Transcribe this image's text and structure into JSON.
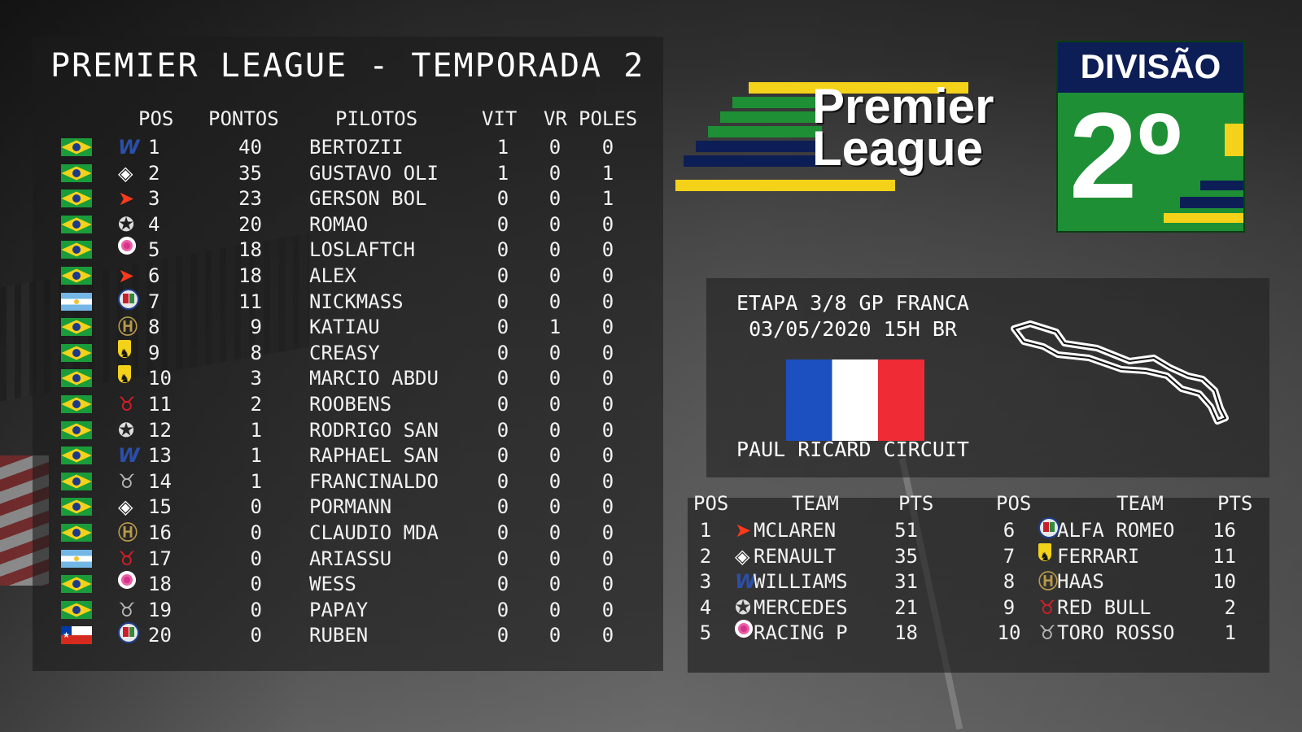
{
  "title": "PREMIER LEAGUE - TEMPORADA 2",
  "logo": {
    "line1": "Premier",
    "line2": "League"
  },
  "division": {
    "label": "DIVISÃO",
    "number": "2º"
  },
  "driver_headers": {
    "pos": "POS",
    "points": "PONTOS",
    "drivers": "PILOTOS",
    "wins": "VIT",
    "fastest_laps": "VR",
    "poles": "POLES"
  },
  "drivers": [
    {
      "pos": "1",
      "flag": "br",
      "team": "williams",
      "points": "40",
      "name": "BERTOZII",
      "vit": "1",
      "vr": "0",
      "poles": "0"
    },
    {
      "pos": "2",
      "flag": "br",
      "team": "renault",
      "points": "35",
      "name": "GUSTAVO OLI",
      "vit": "1",
      "vr": "0",
      "poles": "1"
    },
    {
      "pos": "3",
      "flag": "br",
      "team": "mclaren",
      "points": "23",
      "name": "GERSON BOL",
      "vit": "0",
      "vr": "0",
      "poles": "1"
    },
    {
      "pos": "4",
      "flag": "br",
      "team": "mercedes",
      "points": "20",
      "name": "ROMAO",
      "vit": "0",
      "vr": "0",
      "poles": "0"
    },
    {
      "pos": "5",
      "flag": "br",
      "team": "racingp",
      "points": "18",
      "name": "LOSLAFTCH",
      "vit": "0",
      "vr": "0",
      "poles": "0"
    },
    {
      "pos": "6",
      "flag": "br",
      "team": "mclaren",
      "points": "18",
      "name": "ALEX",
      "vit": "0",
      "vr": "0",
      "poles": "0"
    },
    {
      "pos": "7",
      "flag": "ar",
      "team": "alfa",
      "points": "11",
      "name": "NICKMASS",
      "vit": "0",
      "vr": "0",
      "poles": "0"
    },
    {
      "pos": "8",
      "flag": "br",
      "team": "haas",
      "points": "9",
      "name": "KATIAU",
      "vit": "0",
      "vr": "1",
      "poles": "0"
    },
    {
      "pos": "9",
      "flag": "br",
      "team": "ferrari",
      "points": "8",
      "name": "CREASY",
      "vit": "0",
      "vr": "0",
      "poles": "0"
    },
    {
      "pos": "10",
      "flag": "br",
      "team": "ferrari",
      "points": "3",
      "name": "MARCIO ABDU",
      "vit": "0",
      "vr": "0",
      "poles": "0"
    },
    {
      "pos": "11",
      "flag": "br",
      "team": "redbull",
      "points": "2",
      "name": "ROOBENS",
      "vit": "0",
      "vr": "0",
      "poles": "0"
    },
    {
      "pos": "12",
      "flag": "br",
      "team": "mercedes",
      "points": "1",
      "name": "RODRIGO SAN",
      "vit": "0",
      "vr": "0",
      "poles": "0"
    },
    {
      "pos": "13",
      "flag": "br",
      "team": "williams",
      "points": "1",
      "name": "RAPHAEL SAN",
      "vit": "0",
      "vr": "0",
      "poles": "0"
    },
    {
      "pos": "14",
      "flag": "br",
      "team": "tororosso",
      "points": "1",
      "name": "FRANCINALDO",
      "vit": "0",
      "vr": "0",
      "poles": "0"
    },
    {
      "pos": "15",
      "flag": "br",
      "team": "renault",
      "points": "0",
      "name": "PORMANN",
      "vit": "0",
      "vr": "0",
      "poles": "0"
    },
    {
      "pos": "16",
      "flag": "br",
      "team": "haas",
      "points": "0",
      "name": "CLAUDIO MDA",
      "vit": "0",
      "vr": "0",
      "poles": "0"
    },
    {
      "pos": "17",
      "flag": "ar",
      "team": "redbull",
      "points": "0",
      "name": "ARIASSU",
      "vit": "0",
      "vr": "0",
      "poles": "0"
    },
    {
      "pos": "18",
      "flag": "br",
      "team": "racingp",
      "points": "0",
      "name": "WESS",
      "vit": "0",
      "vr": "0",
      "poles": "0"
    },
    {
      "pos": "19",
      "flag": "br",
      "team": "tororosso",
      "points": "0",
      "name": "PAPAY",
      "vit": "0",
      "vr": "0",
      "poles": "0"
    },
    {
      "pos": "20",
      "flag": "cl",
      "team": "alfa",
      "points": "0",
      "name": "RUBEN",
      "vit": "0",
      "vr": "0",
      "poles": "0"
    }
  ],
  "event": {
    "stage": "ETAPA 3/8 GP FRANCA",
    "datetime": "03/05/2020 15H BR",
    "circuit": "PAUL RICARD CIRCUIT"
  },
  "team_headers": {
    "pos": "POS",
    "team": "TEAM",
    "points": "PTS"
  },
  "teams_left": [
    {
      "pos": "1",
      "team": "mclaren",
      "name": "MCLAREN",
      "points": "51"
    },
    {
      "pos": "2",
      "team": "renault",
      "name": "RENAULT",
      "points": "35"
    },
    {
      "pos": "3",
      "team": "williams",
      "name": "WILLIAMS",
      "points": "31"
    },
    {
      "pos": "4",
      "team": "mercedes",
      "name": "MERCEDES",
      "points": "21"
    },
    {
      "pos": "5",
      "team": "racingp",
      "name": "RACING P",
      "points": "18"
    }
  ],
  "teams_right": [
    {
      "pos": "6",
      "team": "alfa",
      "name": "ALFA ROMEO",
      "points": "16"
    },
    {
      "pos": "7",
      "team": "ferrari",
      "name": "FERRARI",
      "points": "11"
    },
    {
      "pos": "8",
      "team": "haas",
      "name": "HAAS",
      "points": "10"
    },
    {
      "pos": "9",
      "team": "redbull",
      "name": "RED BULL",
      "points": "2"
    },
    {
      "pos": "10",
      "team": "tororosso",
      "name": "TORO ROSSO",
      "points": "1"
    }
  ],
  "colors": {
    "brand_yellow": "#f4d21a",
    "brand_green": "#1e8f34",
    "brand_navy": "#0d1e56"
  }
}
